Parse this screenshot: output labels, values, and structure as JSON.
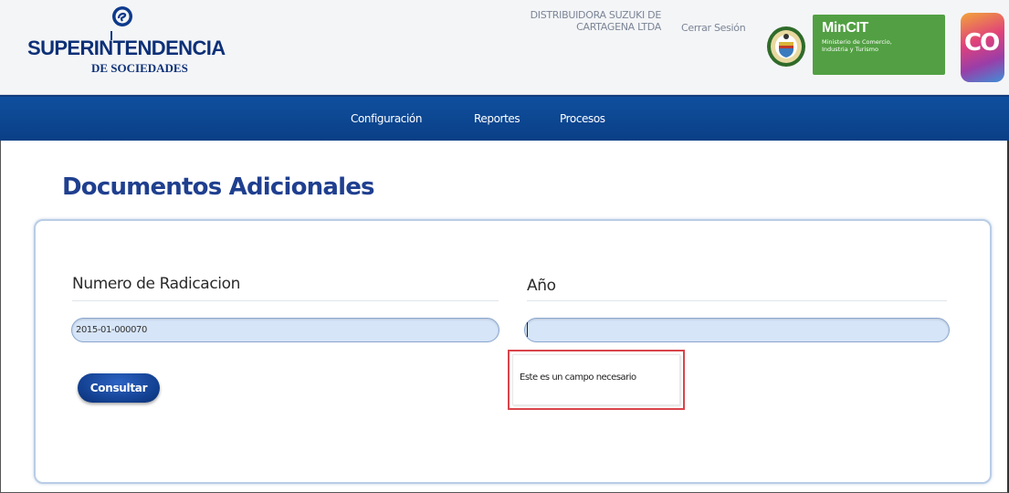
{
  "header": {
    "brand": {
      "name": "SUPERINTENDENCIA",
      "subtitle": "DE SOCIEDADES"
    },
    "company_line1": "DISTRIBUIDORA SUZUKI DE",
    "company_line2": "CARTAGENA LTDA",
    "logout_label": "Cerrar Sesión",
    "mincit": {
      "title": "MinCIT",
      "sub_line1": "Ministerio de Comercio,",
      "sub_line2": "Industria y Turismo"
    },
    "co_logo": {
      "text": "CO",
      "colors": [
        "#f2a53a",
        "#e0417a",
        "#9a3ea8",
        "#3e8fd8"
      ]
    }
  },
  "nav": {
    "items": [
      {
        "label": "Configuración"
      },
      {
        "label": "Reportes"
      },
      {
        "label": "Procesos"
      }
    ],
    "background": "#0a3f86"
  },
  "page": {
    "title": "Documentos Adicionales"
  },
  "form": {
    "radicacion": {
      "label": "Numero de Radicacion",
      "value": "2015-01-000070"
    },
    "anio": {
      "label": "Año",
      "value": ""
    },
    "submit_label": "Consultar",
    "validation_message": "Este es un campo necesario"
  },
  "colors": {
    "accent": "#1f3f8f",
    "error_border": "#d9444b",
    "input_bg": "#d6e5f8",
    "mincit_green": "#52a043"
  },
  "icons": [
    "superintendencia-emblem-icon",
    "colombia-seal-icon"
  ]
}
